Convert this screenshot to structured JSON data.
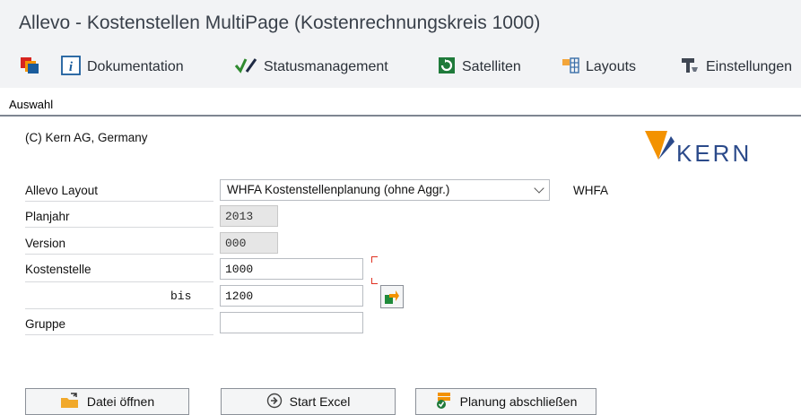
{
  "window": {
    "title": "Allevo - Kostenstellen MultiPage (Kostenrechnungskreis 1000)"
  },
  "toolbar": {
    "documentation": "Dokumentation",
    "status": "Statusmanagement",
    "satellites": "Satelliten",
    "layouts": "Layouts",
    "settings": "Einstellungen"
  },
  "tab": {
    "label": "Auswahl"
  },
  "form": {
    "copyright": "(C) Kern AG, Germany",
    "logo_text": "KERN",
    "layout_label": "Allevo Layout",
    "layout_value": "WHFA Kostenstellenplanung (ohne Aggr.)",
    "layout_code": "WHFA",
    "year_label": "Planjahr",
    "year_value": "2013",
    "version_label": "Version",
    "version_value": "000",
    "cc_label": "Kostenstelle",
    "cc_from": "1000",
    "bis_label": "bis",
    "cc_to": "1200",
    "group_label": "Gruppe",
    "group_value": ""
  },
  "buttons": {
    "open_file": "Datei öffnen",
    "start_excel": "Start Excel",
    "close_planning": "Planung abschließen"
  },
  "colors": {
    "accent": "#1a5c9c",
    "logo_orange": "#f39200",
    "logo_blue": "#2b4a8a",
    "bracket_red": "#e03020"
  }
}
